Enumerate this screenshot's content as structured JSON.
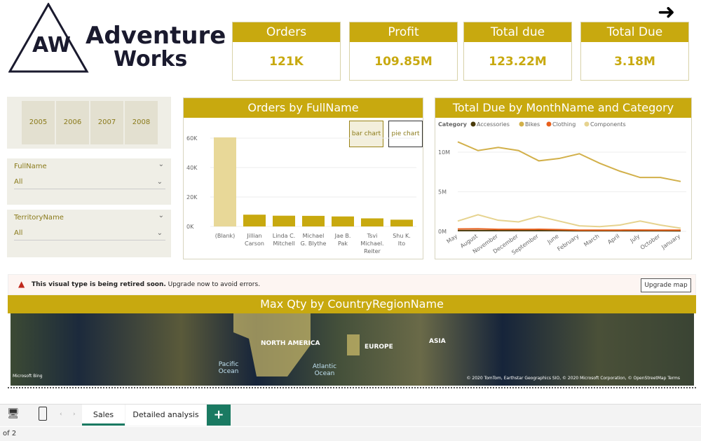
{
  "logo": {
    "text": "Adventure Works"
  },
  "kpis": [
    {
      "label": "Orders",
      "value": "121K"
    },
    {
      "label": "Profit",
      "value": "109.85M"
    },
    {
      "label": "Total due",
      "value": "123.22M"
    },
    {
      "label": "Total Due",
      "value": "3.18M"
    }
  ],
  "years": [
    "2005",
    "2006",
    "2007",
    "2008"
  ],
  "slicers": [
    {
      "label": "FullName",
      "value": "All"
    },
    {
      "label": "TerritoryName",
      "value": "All"
    }
  ],
  "bar_chart_title": "Orders by FullName",
  "toggle": {
    "bar": "bar chart",
    "pie": "pie chart"
  },
  "line_chart_title": "Total Due by MonthName and Category",
  "chart_data": [
    {
      "type": "bar",
      "title": "Orders by FullName",
      "categories": [
        "(Blank)",
        "Jillian Carson",
        "Linda C. Mitchell",
        "Michael G. Blythe",
        "Jae B. Pak",
        "Tsvi Michael. Reiter",
        "Shu K. Ito"
      ],
      "values": [
        60500,
        8000,
        7300,
        7200,
        6800,
        5500,
        4600
      ],
      "yticks": [
        "0K",
        "20K",
        "40K",
        "60K"
      ],
      "ylim": [
        0,
        70000
      ],
      "colors": [
        "#e8d898",
        "#c8a90f"
      ]
    },
    {
      "type": "line",
      "title": "Total Due by MonthName and Category",
      "legend_title": "Category",
      "x": [
        "May",
        "August",
        "November",
        "December",
        "September",
        "June",
        "February",
        "March",
        "April",
        "July",
        "October",
        "January"
      ],
      "yticks": [
        "0M",
        "5M",
        "10M"
      ],
      "ylim": [
        0,
        12000000
      ],
      "series": [
        {
          "name": "Accessories",
          "color": "#4a3a0a",
          "values": [
            100000,
            100000,
            100000,
            100000,
            100000,
            100000,
            80000,
            80000,
            80000,
            80000,
            80000,
            70000
          ]
        },
        {
          "name": "Bikes",
          "color": "#d2b04a",
          "values": [
            11300000,
            10200000,
            10600000,
            10200000,
            8900000,
            9200000,
            9800000,
            8600000,
            7600000,
            6800000,
            6800000,
            6300000
          ]
        },
        {
          "name": "Clothing",
          "color": "#e8601c",
          "values": [
            300000,
            320000,
            250000,
            250000,
            260000,
            220000,
            160000,
            150000,
            160000,
            170000,
            160000,
            150000
          ]
        },
        {
          "name": "Components",
          "color": "#e6d38f",
          "values": [
            1300000,
            2100000,
            1400000,
            1200000,
            1900000,
            1300000,
            700000,
            600000,
            800000,
            1300000,
            800000,
            400000
          ]
        }
      ]
    }
  ],
  "warning": {
    "bold": "This visual type is being retired soon.",
    "rest": " Upgrade now to avoid errors.",
    "button": "Upgrade map"
  },
  "map": {
    "title": "Max Qty by CountryRegionName",
    "labels": {
      "na": "NORTH AMERICA",
      "eu": "EUROPE",
      "asia": "ASIA",
      "pacific": "Pacific Ocean",
      "atlantic": "Atlantic Ocean"
    },
    "bing": "Microsoft Bing",
    "attribution": "© 2020 TomTom, Earthstar Geographics SIO, © 2020 Microsoft Corporation, © OpenStreetMap Terms"
  },
  "tabs": {
    "sales": "Sales",
    "detail": "Detailed analysis",
    "add": "+"
  },
  "page_indicator": "of 2"
}
